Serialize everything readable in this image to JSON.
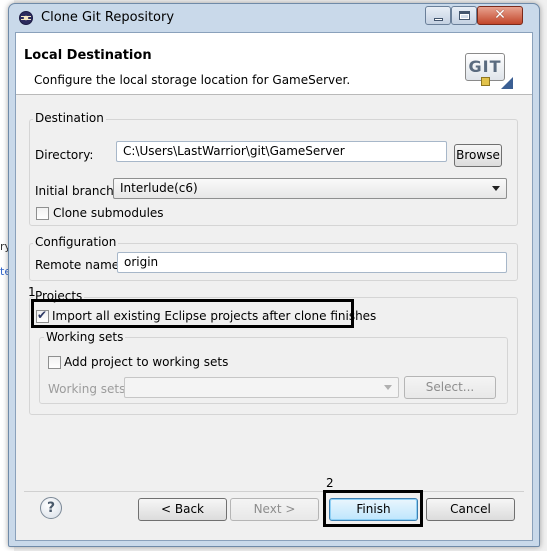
{
  "window": {
    "title": "Clone Git Repository"
  },
  "header": {
    "title": "Local Destination",
    "subtitle": "Configure the local storage location for GameServer.",
    "logo_text": "GIT"
  },
  "background_fragments": [
    "ry",
    "te"
  ],
  "destination": {
    "group_label": "Destination",
    "directory_label": "Directory:",
    "directory_value": "C:\\Users\\LastWarrior\\git\\GameServer",
    "browse_label": "Browse",
    "branch_label": "Initial branch:",
    "branch_value": "Interlude(c6)",
    "clone_submodules_label": "Clone submodules",
    "clone_submodules_checked": false
  },
  "configuration": {
    "group_label": "Configuration",
    "remote_label": "Remote name:",
    "remote_value": "origin"
  },
  "projects": {
    "group_label": "Projects",
    "import_label": "Import all existing Eclipse projects after clone finishes",
    "import_checked": true,
    "working_sets": {
      "group_label": "Working sets",
      "add_label": "Add project to working sets",
      "add_checked": false,
      "sets_label": "Working sets:",
      "sets_value": "",
      "select_label": "Select..."
    }
  },
  "annotations": {
    "one": "1",
    "two": "2"
  },
  "footer": {
    "help_glyph": "?",
    "back_label": "< Back",
    "next_label": "Next >",
    "finish_label": "Finish",
    "cancel_label": "Cancel"
  },
  "colors": {
    "title_bar": "#c9d9ea",
    "close_button": "#c2462a",
    "default_button": "#bee6fd",
    "highlight_box": "#000000"
  }
}
